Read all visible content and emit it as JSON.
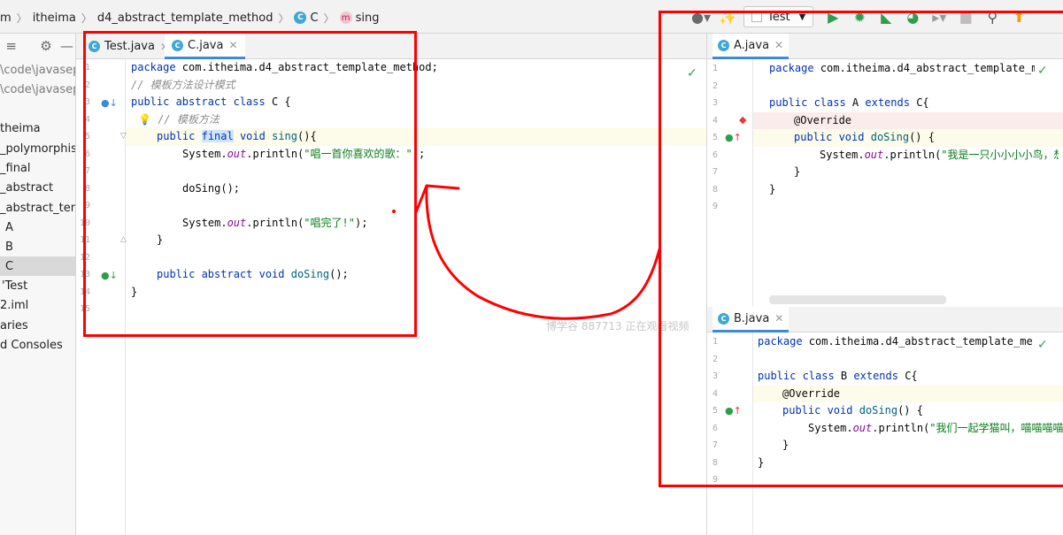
{
  "breadcrumb": {
    "items": [
      "m",
      "itheima",
      "d4_abstract_template_method",
      "C",
      "sing"
    ]
  },
  "toolbar": {
    "run_config_label": "Test"
  },
  "project_tree": {
    "items": [
      {
        "label": "\\code\\javasepr"
      },
      {
        "label": "\\code\\javasepr"
      },
      {
        "label": "theima"
      },
      {
        "label": "_polymorphisr"
      },
      {
        "label": "_final"
      },
      {
        "label": "_abstract"
      },
      {
        "label": "_abstract_temp"
      },
      {
        "label": "A"
      },
      {
        "label": "B"
      },
      {
        "label": "C"
      },
      {
        "label": "Test"
      },
      {
        "label": "2.iml"
      },
      {
        "label": "aries"
      },
      {
        "label": "d Consoles"
      }
    ]
  },
  "editor": {
    "tabs": [
      {
        "label": "Test.java"
      },
      {
        "label": "C.java"
      }
    ],
    "line_numbers": [
      "1",
      "2",
      "3",
      "4",
      "5",
      "6",
      "7",
      "8",
      "9",
      "10",
      "11",
      "12",
      "13",
      "14",
      "15"
    ],
    "lines": {
      "l1_kw": "package",
      "l1_rest": " com.itheima.d4_abstract_template_method;",
      "l2": "// 模板方法设计模式",
      "l3_kw": "public abstract class",
      "l3_rest": " C {",
      "l4": "// 模板方法",
      "l5_kw1": "public",
      "l5_final": "final",
      "l5_kw2": "void",
      "l5_fn": "sing",
      "l5_rest": "(){",
      "l6_pre": "System.",
      "l6_out": "out",
      "l6_mid": ".println(",
      "l6_str": "\"唱一首你喜欢的歌：\"",
      "l6_end": ");",
      "l8": "doSing();",
      "l10_pre": "System.",
      "l10_out": "out",
      "l10_mid": ".println(",
      "l10_str": "\"唱完了!\"",
      "l10_end": ");",
      "l11": "}",
      "l13_kw": "public abstract void",
      "l13_fn": "doSing",
      "l13_rest": "();",
      "l14": "}"
    }
  },
  "right_top": {
    "tab_label": "A.java",
    "line_numbers": [
      "1",
      "2",
      "3",
      "4",
      "5",
      "6",
      "7",
      "8",
      "9"
    ],
    "lines": {
      "l1_kw": "package",
      "l1_rest": " com.itheima.d4_abstract_template_m",
      "l3_kw": "public class",
      "l3_name": " A ",
      "l3_kw2": "extends",
      "l3_rest": " C{",
      "l4": "@Override",
      "l5_kw": "public void",
      "l5_fn": "doSing",
      "l5_rest": "() {",
      "l6_pre": "System.",
      "l6_out": "out",
      "l6_mid": ".println(",
      "l6_str": "\"我是一只小小小小鸟，想",
      "l7": "}",
      "l8": "}"
    }
  },
  "right_bottom": {
    "tab_label": "B.java",
    "line_numbers": [
      "1",
      "2",
      "3",
      "4",
      "5",
      "6",
      "7",
      "8",
      "9"
    ],
    "lines": {
      "l1_kw": "package",
      "l1_rest": " com.itheima.d4_abstract_template_met",
      "l3_kw": "public class",
      "l3_name": " B ",
      "l3_kw2": "extends",
      "l3_rest": " C{",
      "l4": "@Override",
      "l5_kw": "public void",
      "l5_fn": "doSing",
      "l5_rest": "() {",
      "l6_pre": "System.",
      "l6_out": "out",
      "l6_mid": ".println(",
      "l6_str": "\"我们一起学猫叫，喵喵喵喵",
      "l7": "}",
      "l8": "}"
    }
  },
  "watermark": "博学谷 887713 正在观看视频",
  "colors": {
    "annotation_red": "#ff0000",
    "tab_active_underline": "#3d8bd8",
    "keyword_blue": "#0033b3",
    "string_green": "#067d17"
  }
}
